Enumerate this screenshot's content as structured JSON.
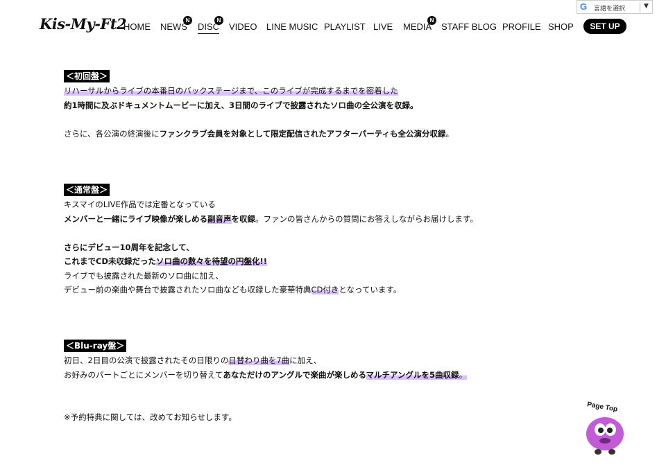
{
  "header": {
    "logo": "Kis-My-Ft2",
    "nav": [
      {
        "label": "HOME"
      },
      {
        "label": "NEWS",
        "badge": "N"
      },
      {
        "label": "DISC",
        "badge": "N"
      },
      {
        "label": "VIDEO"
      },
      {
        "label": "LINE MUSIC"
      },
      {
        "label": "PLAYLIST"
      },
      {
        "label": "LIVE"
      },
      {
        "label": "MEDIA",
        "badge": "N"
      },
      {
        "label": "STAFF BLOG"
      },
      {
        "label": "PROFILE"
      },
      {
        "label": "SHOP"
      }
    ],
    "setup_label": "SET UP",
    "translate": {
      "label": "言語を選択",
      "arrow": "▼"
    }
  },
  "sections": {
    "first": {
      "title": "＜初回盤＞",
      "l1": "リハーサルからライブの本番日のバックステージまで、このライブが完成するまでを密着した",
      "l2": "約1時間に及ぶドキュメントムービーに加え、3日間のライブで披露されたソロ曲の全公演を収録。",
      "l3a": "さらに、各公演の終演後に",
      "l3b": "ファンクラブ会員を対象として限定配信されたアフターパーティも全公演分収録",
      "l3c": "。"
    },
    "normal": {
      "title": "＜通常盤＞",
      "l1": "キスマイのLIVE作品では定番となっている",
      "l2a": "メンバーと一緒にライブ映像が楽しめる",
      "l2b": "副音声",
      "l2c": "を収録",
      "l2d": "。ファンの皆さんからの質問にお答えしながらお届けします。",
      "l3": "さらにデビュー10周年を記念して、",
      "l4a": "これまでCD未収録だった",
      "l4b": "ソロ曲の数々を待望の円盤化!!",
      "l5": "ライブでも披露された最新のソロ曲に加え、",
      "l6a": "デビュー前の楽曲や舞台で披露されたソロ曲なども収録した豪華特典",
      "l6b": "CD付き",
      "l6c": "となっています。"
    },
    "bluray": {
      "title": "＜Blu-ray盤＞",
      "l1a": "初日、2日目の公演で披露されたその日限りの",
      "l1b": "日替わり曲を7曲",
      "l1c": "に加え、",
      "l2a": "お好みのパートごとにメンバーを切り替えて",
      "l2b": "あなただけのアングルで楽曲が楽しめる",
      "l2c": "マルチアングルを5曲収録",
      "l2d": "。"
    },
    "note": "※予約特典に関しては、改めてお知らせします。"
  },
  "page_top": {
    "label": "Page Top"
  },
  "colors": {
    "highlight": "#c08cff",
    "black": "#000000"
  }
}
